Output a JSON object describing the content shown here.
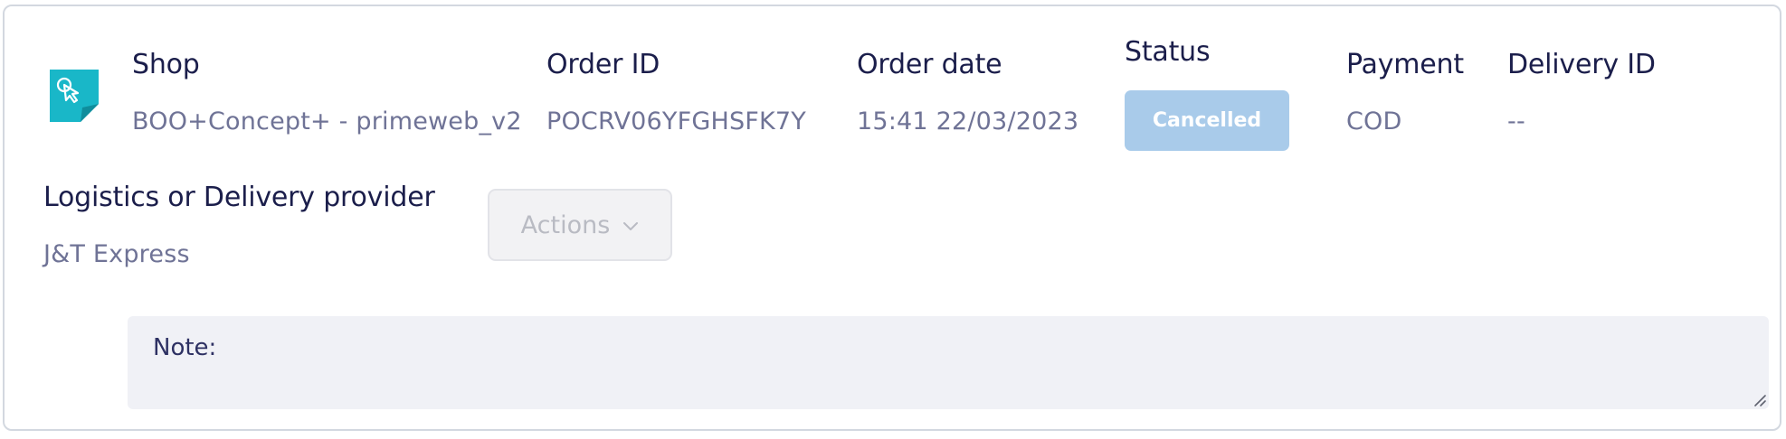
{
  "order": {
    "shop": {
      "label": "Shop",
      "value": "BOO+Concept+ - primeweb_v2"
    },
    "order_id": {
      "label": "Order ID",
      "value": "POCRV06YFGHSFK7Y"
    },
    "order_date": {
      "label": "Order date",
      "value": "15:41 22/03/2023"
    },
    "status": {
      "label": "Status",
      "value": "Cancelled",
      "color": "#a9cbea"
    },
    "payment": {
      "label": "Payment",
      "value": "COD"
    },
    "delivery_id": {
      "label": "Delivery ID",
      "value": "--"
    },
    "logistics": {
      "label": "Logistics or Delivery provider",
      "value": "J&T Express"
    }
  },
  "actions": {
    "label": "Actions",
    "icon": "chevron-down-icon"
  },
  "note": {
    "label": "Note:"
  },
  "icons": {
    "shop": "shop-tag-cursor-icon"
  },
  "colors": {
    "accent": "#1ab9c9",
    "label": "#1b1e4b",
    "value": "#6f7396"
  }
}
